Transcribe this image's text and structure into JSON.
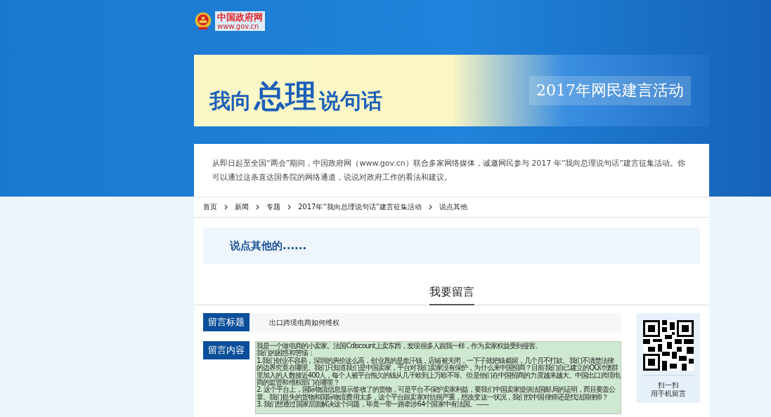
{
  "header": {
    "site_name": "中国政府网",
    "site_url": "www.gov.cn"
  },
  "banner": {
    "title_parts": [
      {
        "text": "我向",
        "big": false
      },
      {
        "text": "总理",
        "big": true
      },
      {
        "text": "说句话",
        "big": false
      }
    ],
    "subtitle": "2017年网民建言活动"
  },
  "intro": "从即日起至全国“两会”期间，中国政府网（www.gov.cn）联合多家网络媒体，诚邀网民参与 2017 年“我向总理说句话”建言征集活动。你可以通过这条直达国务院的网络通道，说说对政府工作的看法和建议。",
  "breadcrumb": [
    "首页",
    "新闻",
    "专题",
    "2017年“我向总理说句话”建言征集活动",
    "说点其他"
  ],
  "topic_title": "说点其他的......",
  "section_heading": "我要留言",
  "form": {
    "fields": [
      {
        "kind": "line",
        "label": "留言标题",
        "value": "出口跨境电商如何维权"
      },
      {
        "kind": "area",
        "label": "留言内容",
        "paragraphs": [
          "我是一个做电商的小卖家。法国Cdiscount上卖东西，发现很多人跟我一样，作为卖家权益受到侵害。",
          "我们的困惑和苦恼：",
          "1.我们创业不容易，深圳的房价这么高，创业真的是血汗钱，店铺被关闭，一下子就把钱截留，几个月不打款。我们不清楚法律的边界究竟在哪里。我们只知道我们是中国卖家，平台对我们卖家没有保护，为什么来中国招商？目前我们自己建立的QQ讨债群里加入的人数接近400人，每个人被平台拖欠的钱从几千欧到上万欧不等。但是他们在中国招商的力度越来越大。中国出口跨境电商的监管和维权部门在哪里？",
          "2. 这个平台上，国际物流信息显示签收了的货物，可是平台不保护卖家利益，要我们中国卖家提供法国邮局的证明，而且要盖公章。我们损失的货物和国际物流费用太多，这个平台跟卖家对抗很严重，想改变这一状况，我们找中国律师还是找法国律师？",
          "3. 我们想通过国家层面解决这个问题，毕竟一带一路牵涉64个国家中有法国。——"
        ]
      }
    ],
    "qr_caption": [
      "扫一扫",
      "用手机留言"
    ]
  }
}
